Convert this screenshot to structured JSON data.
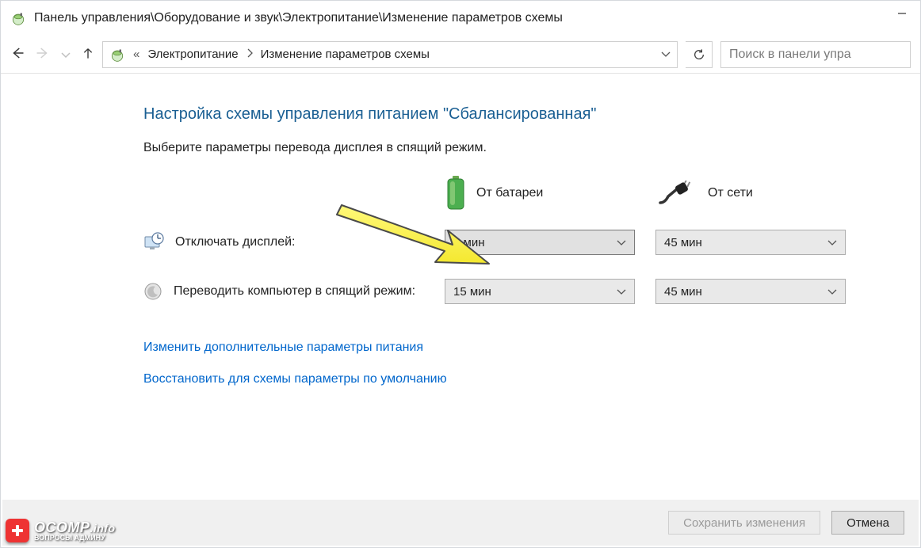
{
  "titlebar": {
    "title": "Панель управления\\Оборудование и звук\\Электропитание\\Изменение параметров схемы"
  },
  "breadcrumb": {
    "first_chevrons": "«",
    "items": [
      "Электропитание",
      "Изменение параметров схемы"
    ]
  },
  "search": {
    "placeholder": "Поиск в панели упра"
  },
  "content": {
    "heading": "Настройка схемы управления питанием \"Сбалансированная\"",
    "description": "Выберите параметры перевода дисплея в спящий режим.",
    "col_battery": "От батареи",
    "col_plugged": "От сети",
    "rows": [
      {
        "label": "Отключать дисплей:",
        "battery": "5 мин",
        "plugged": "45 мин"
      },
      {
        "label": "Переводить компьютер в спящий режим:",
        "battery": "15 мин",
        "plugged": "45 мин"
      }
    ],
    "link_advanced": "Изменить дополнительные параметры питания",
    "link_restore": "Восстановить для схемы параметры по умолчанию"
  },
  "footer": {
    "save": "Сохранить изменения",
    "cancel": "Отмена"
  },
  "watermark": {
    "brand": "OCOMP",
    "suffix": ".info",
    "sub": "ВОПРОСЫ АДМИНУ"
  }
}
